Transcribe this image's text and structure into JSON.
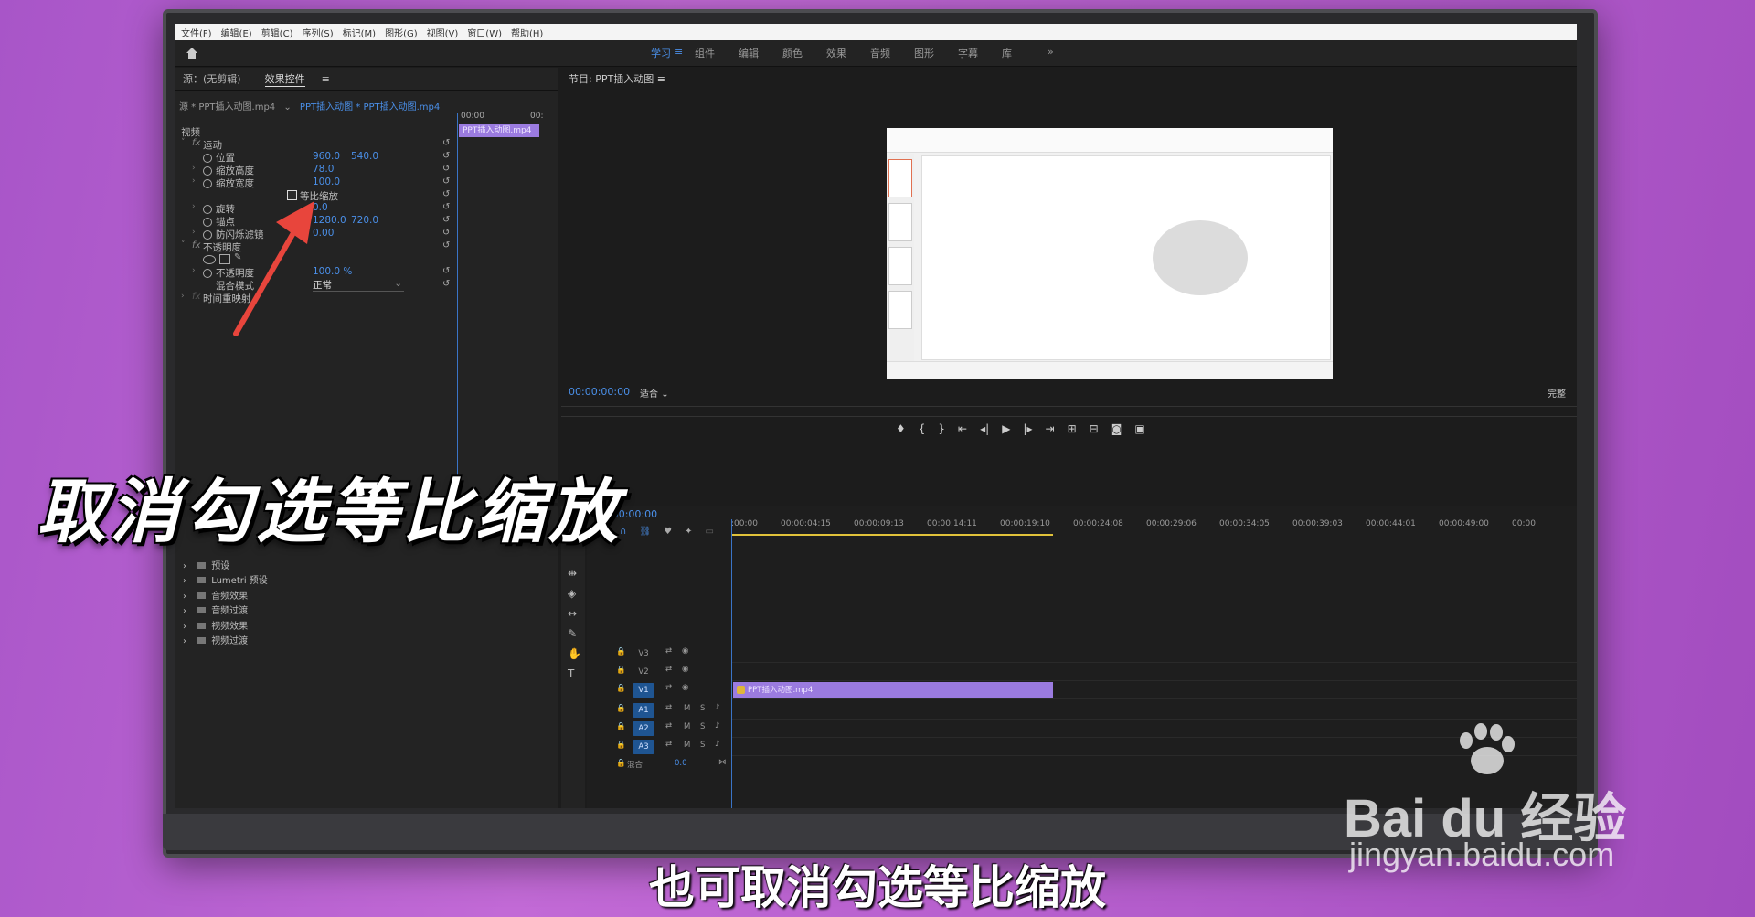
{
  "menu": [
    "文件(F)",
    "编辑(E)",
    "剪辑(C)",
    "序列(S)",
    "标记(M)",
    "图形(G)",
    "视图(V)",
    "窗口(W)",
    "帮助(H)"
  ],
  "workspaces": [
    "学习",
    "组件",
    "编辑",
    "颜色",
    "效果",
    "音频",
    "图形",
    "字幕",
    "库"
  ],
  "workspace_more": "»",
  "source_tabs": {
    "source": "源：(无剪辑)",
    "effects": "效果控件"
  },
  "clip_selector": {
    "source": "源 * PPT插入动图.mp4",
    "sequence": "PPT插入动图 * PPT插入动图.mp4"
  },
  "mini_timeline": {
    "start": "00:00",
    "end": "00:",
    "clip": "PPT插入动图.mp4"
  },
  "effects": {
    "video_header": "视频",
    "motion": "运动",
    "position": {
      "label": "位置",
      "x": "960.0",
      "y": "540.0"
    },
    "scale_h": {
      "label": "缩放高度",
      "v": "78.0"
    },
    "scale_w": {
      "label": "缩放宽度",
      "v": "100.0"
    },
    "uniform": "等比缩放",
    "rotation": {
      "label": "旋转",
      "v": "0.0"
    },
    "anchor": {
      "label": "锚点",
      "x": "1280.0",
      "y": "720.0"
    },
    "flicker": {
      "label": "防闪烁滤镜",
      "v": "0.00"
    },
    "opacity_header": "不透明度",
    "opacity": {
      "label": "不透明度",
      "v": "100.0 %"
    },
    "blend": {
      "label": "混合模式",
      "v": "正常"
    },
    "time_remap": "时间重映射"
  },
  "program": {
    "title": "节目: PPT插入动图",
    "timecode": "00:00:00:00",
    "fit": "适合",
    "quality": "完整"
  },
  "project_items": [
    "预设",
    "Lumetri 预设",
    "音频效果",
    "音频过渡",
    "视频效果",
    "视频过渡"
  ],
  "timeline": {
    "timecode": "00:00:00:00",
    "ruler": [
      ":00:00",
      "00:00:04:15",
      "00:00:09:13",
      "00:00:14:11",
      "00:00:19:10",
      "00:00:24:08",
      "00:00:29:06",
      "00:00:34:05",
      "00:00:39:03",
      "00:00:44:01",
      "00:00:49:00",
      "00:00"
    ],
    "tracks": [
      {
        "name": "V3",
        "on": false
      },
      {
        "name": "V2",
        "on": false
      },
      {
        "name": "V1",
        "on": true
      },
      {
        "name": "A1",
        "on": true
      },
      {
        "name": "A2",
        "on": true
      },
      {
        "name": "A3",
        "on": true
      }
    ],
    "mix": {
      "label": "混合",
      "v": "0.0"
    },
    "clip": "PPT插入动图.mp4"
  },
  "overlay_title": "取消勾选等比缩放",
  "subtitle": "也可取消勾选等比缩放",
  "watermark": {
    "main": "Bai du 经验",
    "sub": "jingyan.baidu.com"
  }
}
